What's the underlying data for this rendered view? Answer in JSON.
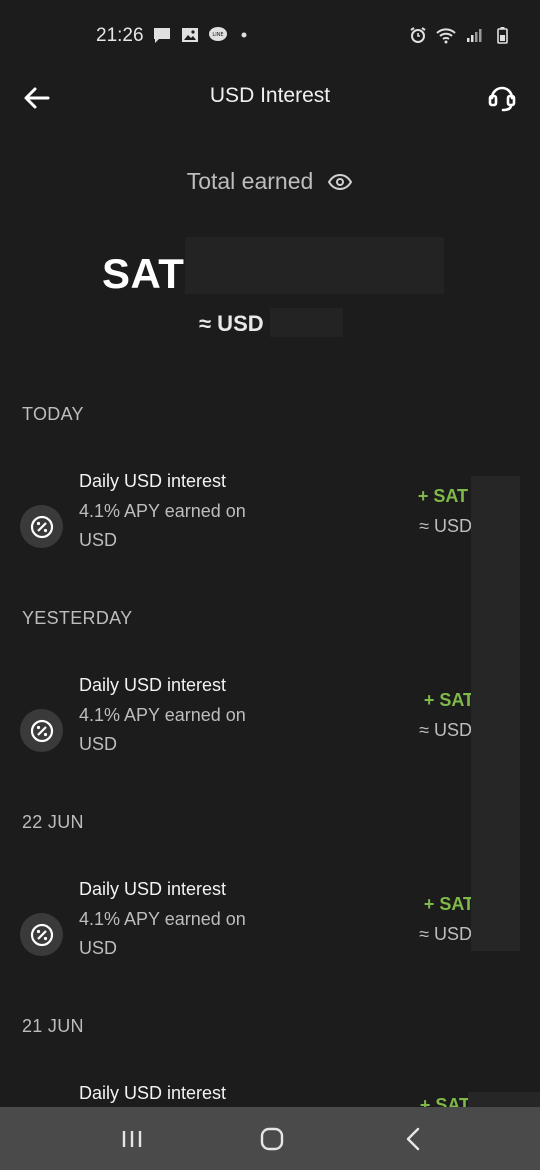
{
  "status_bar": {
    "time": "21:26",
    "notification_icons": [
      "chat-icon",
      "image-icon",
      "line-icon",
      "dot-icon"
    ],
    "system_icons": [
      "alarm-icon",
      "wifi-icon",
      "signal-icon",
      "battery-icon"
    ]
  },
  "header": {
    "title": "USD Interest",
    "back_icon": "arrow-left-icon",
    "support_icon": "headset-icon"
  },
  "summary": {
    "total_label": "Total earned",
    "balance_prefix": "SAT",
    "balance_usd_prefix": "≈ USD"
  },
  "sections": [
    {
      "label": "TODAY",
      "tx": {
        "title": "Daily USD interest",
        "sub1": "4.1% APY earned on",
        "sub2": "USD",
        "amount": "+ SAT",
        "amount_usd": "≈ USD"
      }
    },
    {
      "label": "YESTERDAY",
      "tx": {
        "title": "Daily USD interest",
        "sub1": "4.1% APY earned on",
        "sub2": "USD",
        "amount": "+ SAT",
        "amount_usd": "≈ USD"
      }
    },
    {
      "label": "22 JUN",
      "tx": {
        "title": "Daily USD interest",
        "sub1": "4.1% APY earned on",
        "sub2": "USD",
        "amount": "+ SAT",
        "amount_usd": "≈ USD"
      }
    },
    {
      "label": "21 JUN",
      "tx": {
        "title": "Daily USD interest",
        "amount": "+ SAT"
      }
    }
  ],
  "colors": {
    "background": "#1c1c1c",
    "positive_amount": "#7fb94a",
    "nav_bar": "#4a4a4a"
  }
}
